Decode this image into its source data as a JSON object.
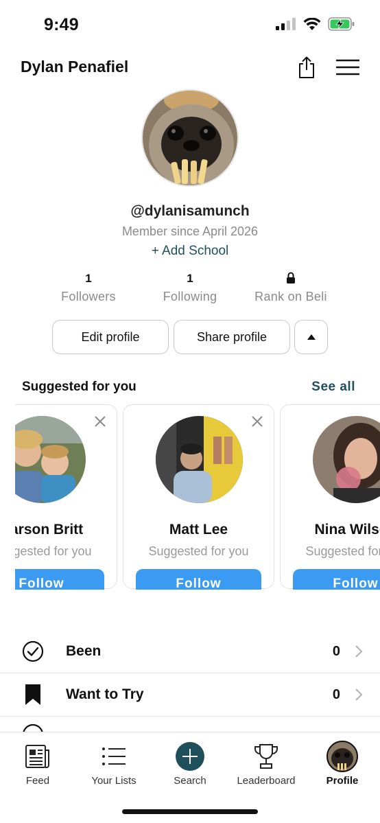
{
  "status_bar": {
    "time": "9:49",
    "icons": [
      "cellular-signal-icon",
      "wifi-icon",
      "battery-charging-icon"
    ],
    "battery_color": "#34c759"
  },
  "header": {
    "name": "Dylan Penafiel",
    "icons": [
      "share-icon",
      "menu-icon"
    ]
  },
  "profile": {
    "handle": "@dylanisamunch",
    "member_since": "Member since April 2026",
    "add_school": "+ Add School"
  },
  "stats": [
    {
      "value": "1",
      "label": "Followers"
    },
    {
      "value": "1",
      "label": "Following"
    },
    {
      "value": "",
      "label": "Rank on Beli",
      "icon": "lock-icon"
    }
  ],
  "actions": {
    "edit_profile": "Edit profile",
    "share_profile": "Share profile",
    "toggle_icon": "caret-up-icon"
  },
  "suggested": {
    "title": "Suggested for you",
    "see_all": "See all",
    "cards": [
      {
        "name": "Carson Britt",
        "subtitle": "Suggested for you",
        "button": "Follow"
      },
      {
        "name": "Matt Lee",
        "subtitle": "Suggested for you",
        "button": "Follow"
      },
      {
        "name": "Nina Wilson",
        "subtitle": "Suggested for you",
        "button": "Follow"
      }
    ]
  },
  "lists": [
    {
      "label": "Been",
      "count": "0",
      "icon": "check-circle-icon"
    },
    {
      "label": "Want to Try",
      "count": "0",
      "icon": "bookmark-icon"
    }
  ],
  "tabbar": {
    "tabs": [
      {
        "label": "Feed",
        "icon": "newspaper-icon"
      },
      {
        "label": "Your Lists",
        "icon": "list-icon"
      },
      {
        "label": "Search",
        "icon": "plus-circle-icon"
      },
      {
        "label": "Leaderboard",
        "icon": "trophy-icon"
      },
      {
        "label": "Profile",
        "icon": "profile-avatar-icon",
        "active": true
      }
    ]
  },
  "colors": {
    "accent_teal": "#1f4f5a",
    "follow_blue": "#3b9bf2",
    "muted_text": "#8a8a8a"
  }
}
